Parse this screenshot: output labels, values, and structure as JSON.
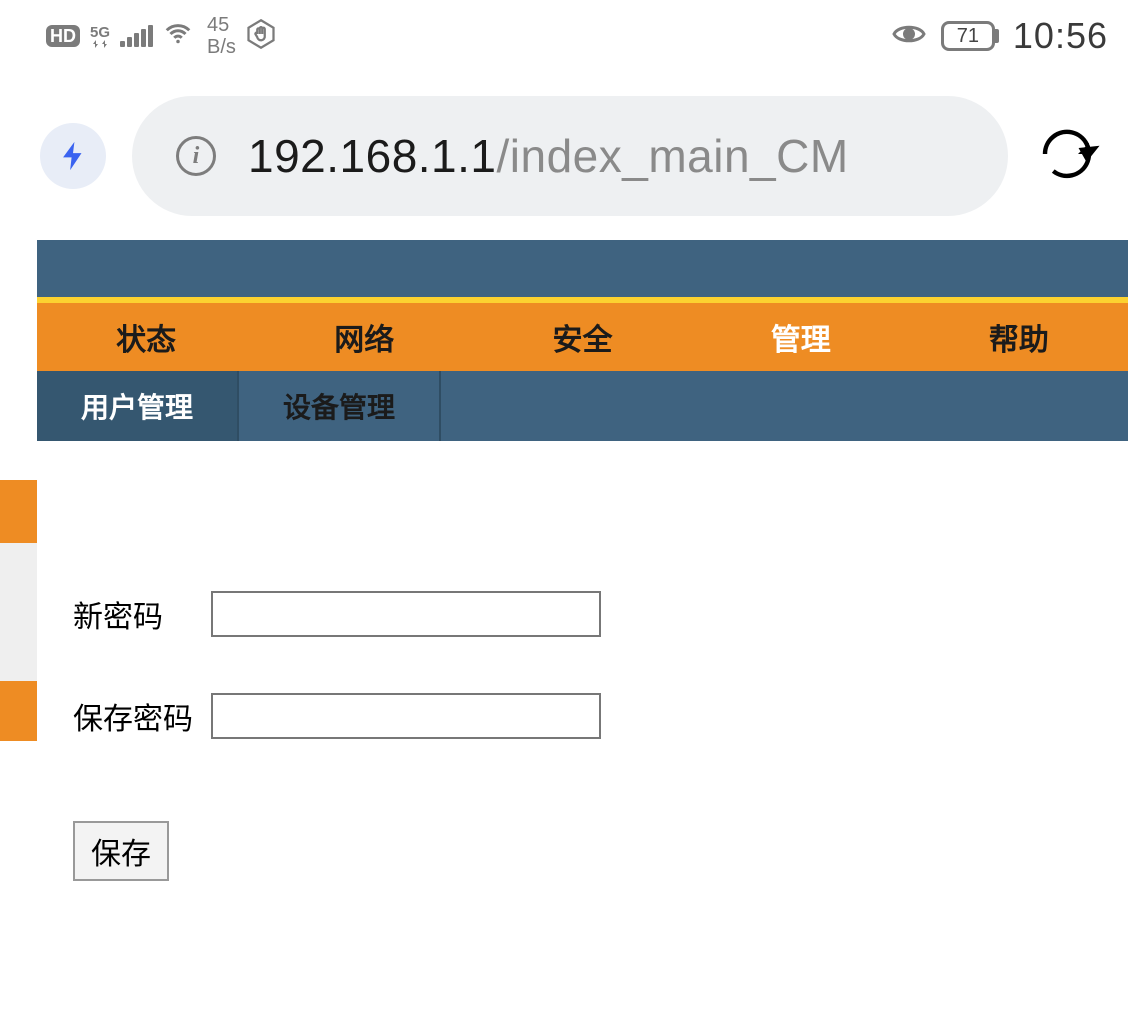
{
  "status": {
    "hd": "HD",
    "network_label": "5G",
    "rate_value": "45",
    "rate_unit": "B/s",
    "battery_pct": "71",
    "clock": "10:56"
  },
  "browser": {
    "url_host": "192.168.1.1",
    "url_path": "/index_main_CM"
  },
  "nav": {
    "tabs": [
      "状态",
      "网络",
      "安全",
      "管理",
      "帮助"
    ],
    "active_index": 3,
    "subtabs": [
      "用户管理",
      "设备管理"
    ],
    "subtab_active_index": 0
  },
  "form": {
    "new_password_label": "新密码",
    "save_password_label": "保存密码",
    "new_password_value": "",
    "save_password_value": "",
    "save_button": "保存"
  }
}
